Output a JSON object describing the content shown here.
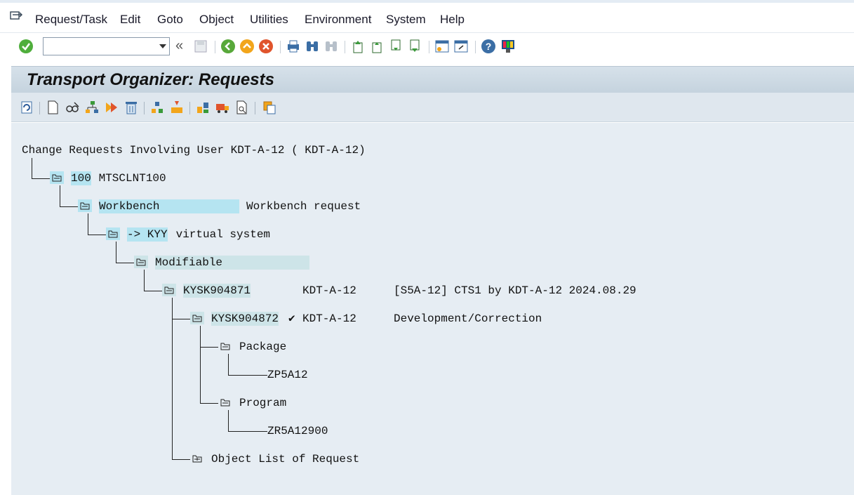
{
  "menu": {
    "items": [
      "Request/Task",
      "Edit",
      "Goto",
      "Object",
      "Utilities",
      "Environment",
      "System",
      "Help"
    ]
  },
  "toolbar": {
    "command_value": "",
    "back_glyph": "«"
  },
  "title": "Transport Organizer: Requests",
  "tree": {
    "root": "Change Requests Involving User KDT-A-12 ( KDT-A-12)",
    "client_num": "100",
    "client_name": " MTSCLNT100",
    "category": "Workbench",
    "category_desc": "Workbench request",
    "target": "-> KYY",
    "target_desc": " virtual system",
    "status": "Modifiable",
    "request_id": "KYSK904871",
    "request_owner": "KDT-A-12",
    "request_desc": "[S5A-12] CTS1 by KDT-A-12 2024.08.29",
    "task_id_a": "KYSK",
    "task_id_b": "904872",
    "task_check": "✔",
    "task_owner": "KDT-A-12",
    "task_type": "Development/Correction",
    "node_package": "Package",
    "package_name": "ZP5A12",
    "node_program": "Program",
    "program_name": "ZR5A12900",
    "object_list": "Object List of Request"
  },
  "colors": {
    "accent_highlight": "#b5e4f1",
    "content_bg": "#e6edf3",
    "title_bg": "#c5d3de"
  }
}
